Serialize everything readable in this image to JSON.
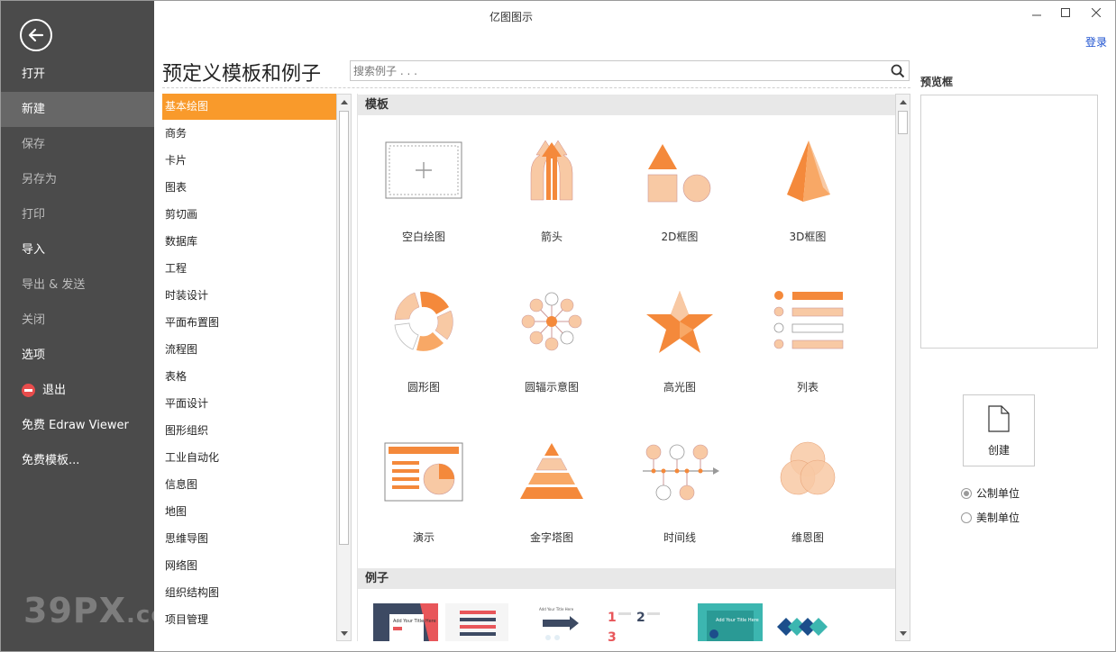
{
  "window": {
    "title": "亿图图示",
    "login": "登录"
  },
  "sidebar": {
    "items": [
      {
        "label": "打开"
      },
      {
        "label": "新建"
      },
      {
        "label": "保存"
      },
      {
        "label": "另存为"
      },
      {
        "label": "打印"
      },
      {
        "label": "导入"
      },
      {
        "label": "导出 & 发送"
      },
      {
        "label": "关闭"
      },
      {
        "label": "选项"
      },
      {
        "label": "退出"
      },
      {
        "label": "免费 Edraw Viewer"
      },
      {
        "label": "免费模板..."
      }
    ],
    "active": "新建",
    "watermark_main": "39PX",
    "watermark_suffix": ".com"
  },
  "main": {
    "title": "预定义模板和例子",
    "search_placeholder": "搜索例子 . . ."
  },
  "categories": [
    "基本绘图",
    "商务",
    "卡片",
    "图表",
    "剪切画",
    "数据库",
    "工程",
    "时装设计",
    "平面布置图",
    "流程图",
    "表格",
    "平面设计",
    "图形组织",
    "工业自动化",
    "信息图",
    "地图",
    "思维导图",
    "网络图",
    "组织结构图",
    "项目管理"
  ],
  "templates": {
    "section_title": "模板",
    "items": [
      {
        "label": "空白绘图",
        "icon": "blank-drawing-icon"
      },
      {
        "label": "箭头",
        "icon": "arrows-icon"
      },
      {
        "label": "2D框图",
        "icon": "2d-block-icon"
      },
      {
        "label": "3D框图",
        "icon": "3d-block-icon"
      },
      {
        "label": "圆形图",
        "icon": "circular-chart-icon"
      },
      {
        "label": "圆辐示意图",
        "icon": "radial-diagram-icon"
      },
      {
        "label": "高光图",
        "icon": "highlight-star-icon"
      },
      {
        "label": "列表",
        "icon": "list-icon"
      },
      {
        "label": "演示",
        "icon": "presentation-icon"
      },
      {
        "label": "金字塔图",
        "icon": "pyramid-icon"
      },
      {
        "label": "时间线",
        "icon": "timeline-icon"
      },
      {
        "label": "维恩图",
        "icon": "venn-icon"
      }
    ]
  },
  "examples": {
    "section_title": "例子",
    "thumbs": [
      {
        "caption": "Add Your Title Here"
      },
      {
        "caption": "Add Your Title Here"
      },
      {
        "caption": "Add Your Title Here"
      }
    ],
    "numbers": [
      "1",
      "2",
      "3"
    ]
  },
  "right_panel": {
    "preview_label": "预览框",
    "create_label": "创建",
    "unit_metric": "公制单位",
    "unit_us": "美制单位"
  },
  "colors": {
    "accent": "#f99a2b",
    "sidebar_bg": "#4b4b4b",
    "icon_orange": "#f4893b",
    "icon_peach": "#f8c9a4"
  }
}
